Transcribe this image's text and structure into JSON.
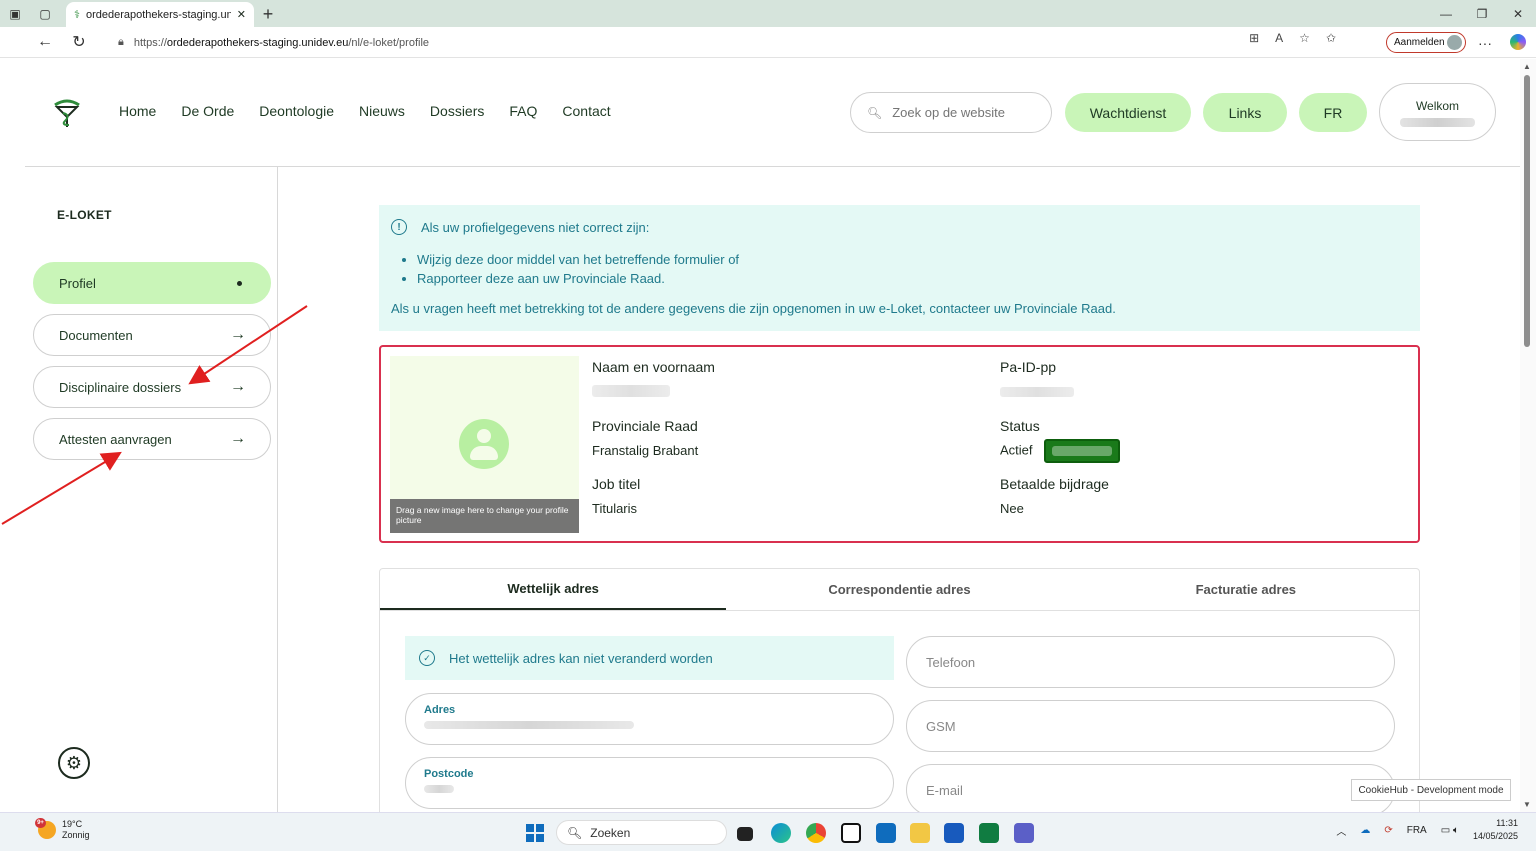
{
  "browser": {
    "tab_title": "ordederapothekers-staging.unidev.eu",
    "url_prefix": "https://",
    "url_host": "ordederapothekers-staging.unidev.eu",
    "url_path": "/nl/e-loket/profile",
    "signin_label": "Aanmelden"
  },
  "header": {
    "nav": [
      "Home",
      "De Orde",
      "Deontologie",
      "Nieuws",
      "Dossiers",
      "FAQ",
      "Contact"
    ],
    "search_placeholder": "Zoek op de website",
    "wachtdienst": "Wachtdienst",
    "links": "Links",
    "lang": "FR",
    "welcome": "Welkom"
  },
  "sidebar": {
    "title": "E-LOKET",
    "items": [
      {
        "label": "Profiel",
        "active": true
      },
      {
        "label": "Documenten",
        "active": false
      },
      {
        "label": "Disciplinaire dossiers",
        "active": false
      },
      {
        "label": "Attesten aanvragen",
        "active": false
      }
    ]
  },
  "info": {
    "heading": "Als uw profielgegevens niet correct zijn:",
    "bullets": [
      "Wijzig deze door middel van het betreffende formulier of",
      "Rapporteer deze aan uw Provinciale Raad."
    ],
    "footer": "Als u vragen heeft met betrekking tot de andere gegevens die zijn opgenomen in uw e-Loket, contacteer uw Provinciale Raad."
  },
  "profile": {
    "drag_hint": "Drag a new image here to change your profile picture",
    "name_label": "Naam en voornaam",
    "paid_label": "Pa-ID-pp",
    "raad_label": "Provinciale Raad",
    "raad_value": "Franstalig Brabant",
    "status_label": "Status",
    "status_value": "Actief",
    "job_label": "Job titel",
    "job_value": "Titularis",
    "bijdrage_label": "Betaalde bijdrage",
    "bijdrage_value": "Nee"
  },
  "address": {
    "tabs": [
      "Wettelijk adres",
      "Correspondentie adres",
      "Facturatie adres"
    ],
    "notice": "Het wettelijk adres kan niet veranderd worden",
    "adres_label": "Adres",
    "postcode_label": "Postcode",
    "telefoon": "Telefoon",
    "gsm": "GSM",
    "email": "E-mail"
  },
  "cookiehub": "CookieHub - Development mode",
  "taskbar": {
    "temp": "19°C",
    "weather": "Zonnig",
    "badge": "9+",
    "search": "Zoeken",
    "lang": "FRA",
    "time": "11:31",
    "date": "14/05/2025"
  },
  "colors": {
    "accent_green": "#c9f5b8",
    "info_teal": "#1f7a8c",
    "profile_border": "#d9304f",
    "annotation_arrow": "#e02020"
  }
}
